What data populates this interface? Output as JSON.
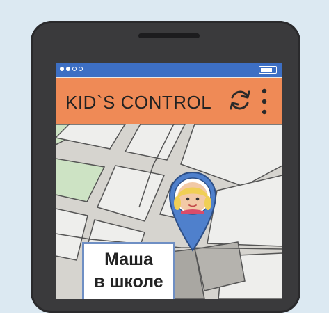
{
  "app": {
    "title": "KID`S CONTROL"
  },
  "statusbar": {
    "indicator_dots": 4,
    "battery_level": 0.85
  },
  "toolbar": {
    "refresh_icon": "refresh-icon",
    "menu_icon": "more-vertical-icon"
  },
  "map": {
    "child_marker": {
      "icon": "child-avatar-icon"
    },
    "status_label": {
      "line1": "Маша",
      "line2": "в школе"
    }
  },
  "colors": {
    "background": "#dce9f2",
    "phone_body": "#3a3a3c",
    "status_bar": "#3d6fc4",
    "app_bar": "#ef8a56",
    "map_block": "#eeeeec",
    "map_road": "#d6d4cf",
    "map_park": "#cde3c4",
    "pin": "#4f80cc",
    "label_border": "#6f8fc4"
  }
}
